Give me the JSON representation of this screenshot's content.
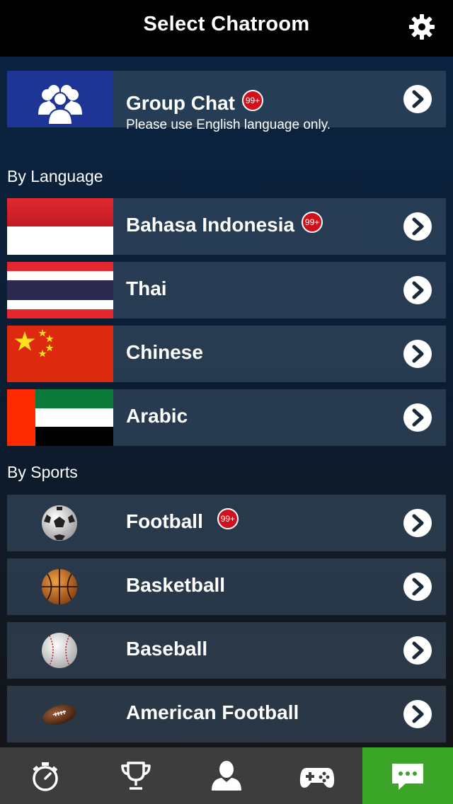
{
  "header": {
    "title": "Select Chatroom",
    "settings_icon": "gear-icon"
  },
  "group_chat": {
    "title": "Group Chat",
    "badge": "99+",
    "subtitle": "Please use English language only.",
    "icon": "group-icon"
  },
  "sections": {
    "language": "By Language",
    "sports": "By Sports"
  },
  "languages": [
    {
      "label": "Bahasa Indonesia",
      "badge": "99+",
      "flag": "indonesia-flag"
    },
    {
      "label": "Thai",
      "badge": "",
      "flag": "thailand-flag"
    },
    {
      "label": "Chinese",
      "badge": "",
      "flag": "china-flag"
    },
    {
      "label": "Arabic",
      "badge": "",
      "flag": "uae-flag"
    }
  ],
  "sports": [
    {
      "label": "Football",
      "badge": "99+",
      "icon": "soccer-ball-icon"
    },
    {
      "label": "Basketball",
      "badge": "",
      "icon": "basketball-icon"
    },
    {
      "label": "Baseball",
      "badge": "",
      "icon": "baseball-icon"
    },
    {
      "label": "American Football",
      "badge": "",
      "icon": "american-football-icon"
    }
  ],
  "tabbar": {
    "tabs": [
      "stopwatch-icon",
      "trophy-icon",
      "person-icon",
      "gamepad-icon",
      "chat-icon"
    ],
    "active": "chat-icon"
  },
  "colors": {
    "badge": "#d0111b",
    "active_tab": "#3aa527",
    "group_thumb": "#1f3595"
  }
}
